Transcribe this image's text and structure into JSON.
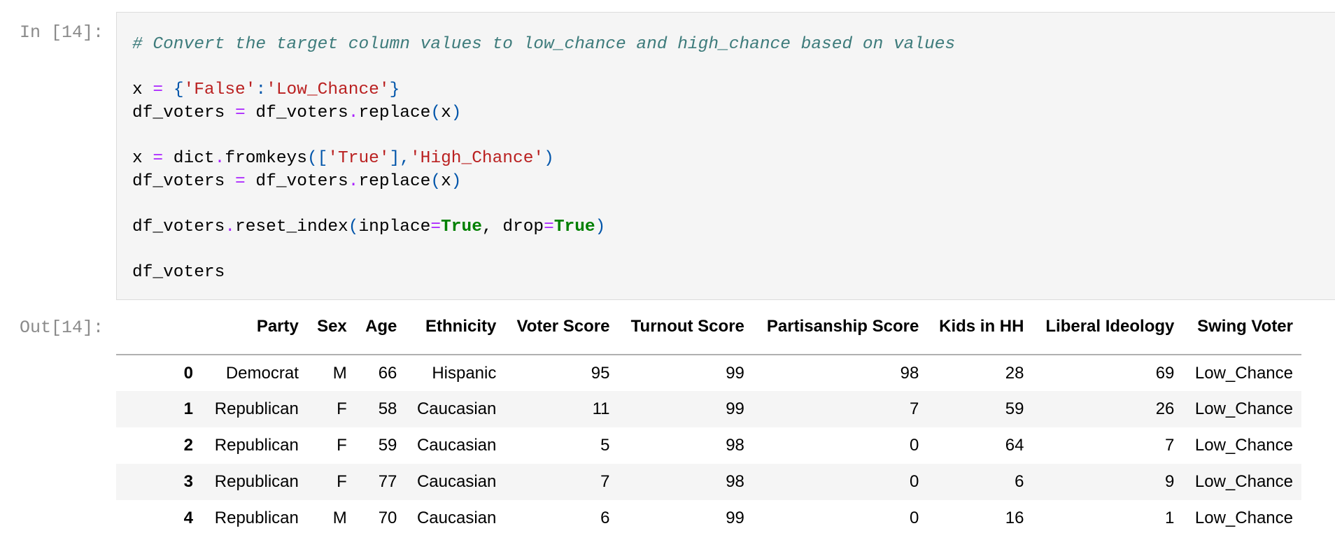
{
  "cell": {
    "in_prompt": "In [14]:",
    "out_prompt": "Out[14]:"
  },
  "code": {
    "comment": "# Convert the target column values to low_chance and high_chance based on values",
    "line1": {
      "var": "x",
      "eq": "=",
      "lbrace": "{",
      "key": "'False'",
      "colon": ":",
      "val": "'Low_Chance'",
      "rbrace": "}"
    },
    "line2": {
      "lhs": "df_voters ",
      "eq": "=",
      "rhs_obj": " df_voters",
      "dot": ".",
      "method": "replace",
      "lp": "(",
      "arg": "x",
      "rp": ")"
    },
    "line3": {
      "var": "x ",
      "eq": "=",
      "obj": " dict",
      "dot": ".",
      "method": "fromkeys",
      "lp": "(",
      "lb": "[",
      "s1": "'True'",
      "rb": "]",
      "comma": ",",
      "s2": "'High_Chance'",
      "rp": ")"
    },
    "line4": {
      "lhs": "df_voters ",
      "eq": "=",
      "rhs_obj": " df_voters",
      "dot": ".",
      "method": "replace",
      "lp": "(",
      "arg": "x",
      "rp": ")"
    },
    "line5": {
      "obj": "df_voters",
      "dot": ".",
      "method": "reset_index",
      "lp": "(",
      "p1": "inplace",
      "eq1": "=",
      "v1": "True",
      "comma": ", ",
      "p2": "drop",
      "eq2": "=",
      "v2": "True",
      "rp": ")"
    },
    "line6": "df_voters"
  },
  "table": {
    "columns": [
      "Party",
      "Sex",
      "Age",
      "Ethnicity",
      "Voter Score",
      "Turnout Score",
      "Partisanship Score",
      "Kids in HH",
      "Liberal Ideology",
      "Swing Voter"
    ],
    "rows": [
      {
        "index": "0",
        "cells": [
          "Democrat",
          "M",
          "66",
          "Hispanic",
          "95",
          "99",
          "98",
          "28",
          "69",
          "Low_Chance"
        ]
      },
      {
        "index": "1",
        "cells": [
          "Republican",
          "F",
          "58",
          "Caucasian",
          "11",
          "99",
          "7",
          "59",
          "26",
          "Low_Chance"
        ]
      },
      {
        "index": "2",
        "cells": [
          "Republican",
          "F",
          "59",
          "Caucasian",
          "5",
          "98",
          "0",
          "64",
          "7",
          "Low_Chance"
        ]
      },
      {
        "index": "3",
        "cells": [
          "Republican",
          "F",
          "77",
          "Caucasian",
          "7",
          "98",
          "0",
          "6",
          "9",
          "Low_Chance"
        ]
      },
      {
        "index": "4",
        "cells": [
          "Republican",
          "M",
          "70",
          "Caucasian",
          "6",
          "99",
          "0",
          "16",
          "1",
          "Low_Chance"
        ]
      }
    ]
  },
  "colors": {
    "comment": "#3d7b7b",
    "operator": "#aa22ff",
    "string": "#ba2121",
    "keyword": "#008000",
    "punctuation": "#0055aa",
    "prompt": "#8a8a8a"
  }
}
